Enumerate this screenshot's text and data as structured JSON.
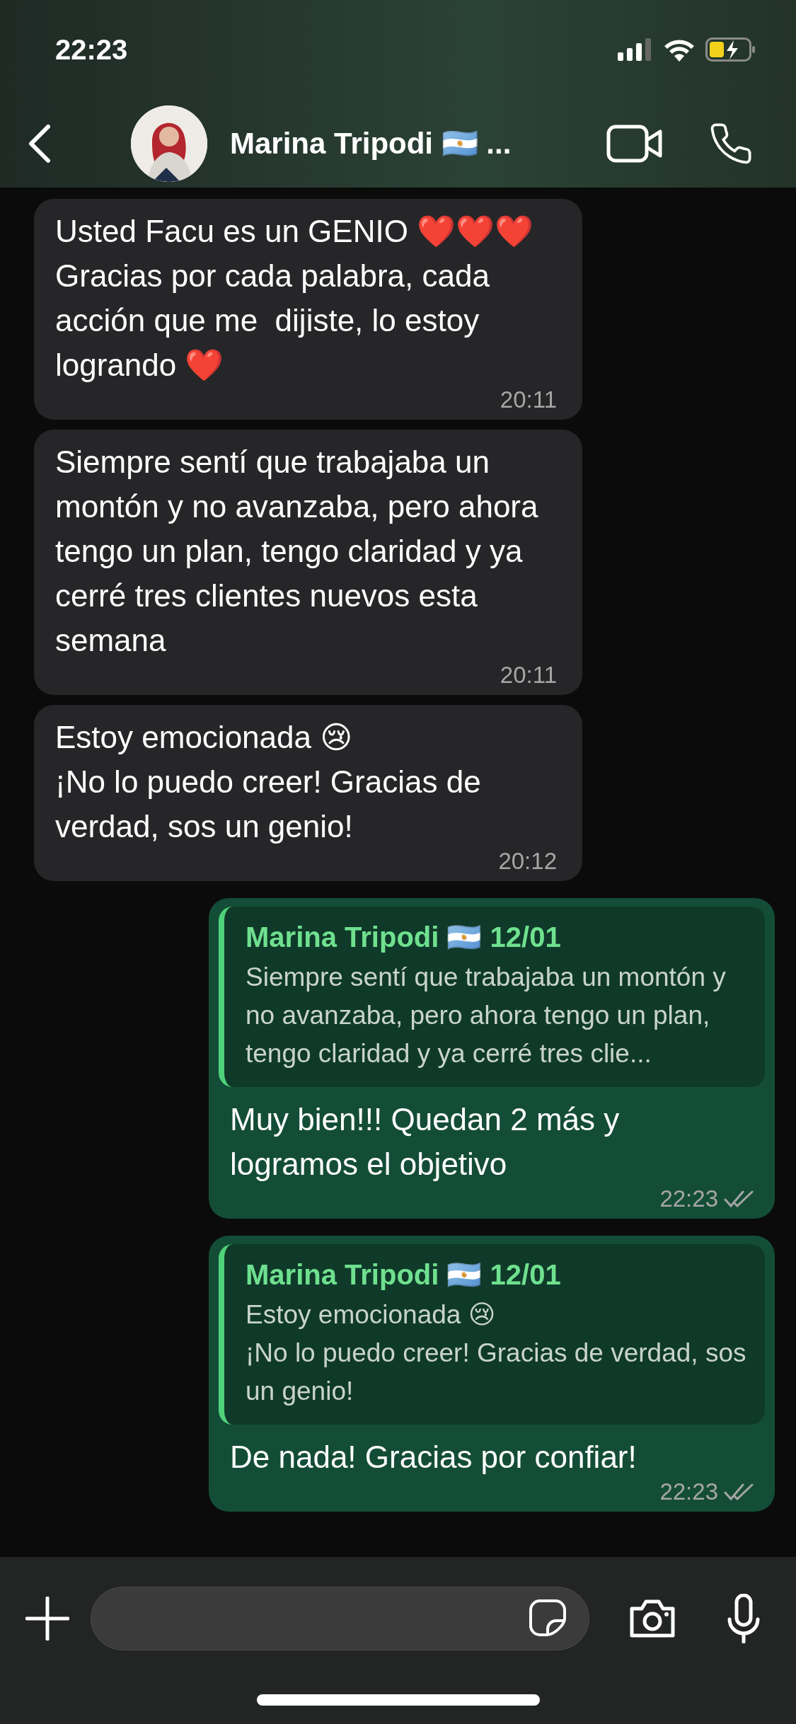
{
  "status_bar": {
    "time": "22:23"
  },
  "header": {
    "contact_name": "Marina Tripodi 🇦🇷 ..."
  },
  "messages": [
    {
      "kind": "incoming",
      "text": "Usted Facu es un GENIO ❤️❤️❤️Gracias por cada palabra, cada acción que me  dijiste, lo estoy logrando ❤️",
      "time": "20:11"
    },
    {
      "kind": "incoming",
      "text": "Siempre sentí que trabajaba un montón y no avanzaba, pero ahora tengo un plan, tengo claridad y ya cerré tres clientes nuevos esta semana",
      "time": "20:11"
    },
    {
      "kind": "incoming",
      "text": "Estoy emocionada 😢\n¡No lo puedo creer! Gracias de verdad, sos un genio!",
      "time": "20:12"
    },
    {
      "kind": "outgoing",
      "quote": {
        "author": "Marina Tripodi 🇦🇷 12/01",
        "text": "Siempre sentí que trabajaba un montón y no avanzaba, pero ahora tengo un plan, tengo claridad y ya cerré tres clie..."
      },
      "text": "Muy bien!!! Quedan 2 más y logramos el objetivo",
      "time": "22:23",
      "read": false
    },
    {
      "kind": "outgoing",
      "quote": {
        "author": "Marina Tripodi 🇦🇷 12/01",
        "text": "Estoy emocionada 😢\n¡No lo puedo creer! Gracias de verdad, sos un genio!"
      },
      "text": "De nada! Gracias por confiar!",
      "time": "22:23",
      "read": false
    }
  ]
}
